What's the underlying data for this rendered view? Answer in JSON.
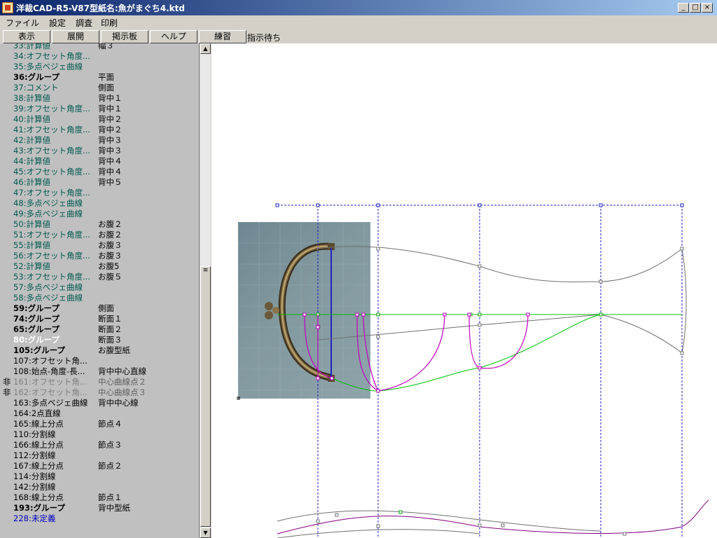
{
  "window": {
    "title": "洋裁CAD-R5-V87型紙名:魚がまぐち4.ktd"
  },
  "menubar": {
    "items": [
      "ファイル",
      "設定",
      "調査",
      "印刷"
    ]
  },
  "toolbar": {
    "buttons": [
      "表示",
      "展開",
      "掲示板",
      "ヘルプ",
      "練習"
    ],
    "status": "指示待ち"
  },
  "colors": {
    "teal": "#005a50",
    "black": "#000000",
    "white": "#ffffff",
    "gray": "#808080",
    "blue": "#0000c0",
    "magenta": "#c000c0",
    "green": "#00c000",
    "dashed_blue": "#2020c0"
  },
  "tree": [
    {
      "prefix": "",
      "label": "33:計算値",
      "note": "幅３",
      "color": "teal",
      "bold": false
    },
    {
      "prefix": "",
      "label": "34:オフセット角度...",
      "note": "",
      "color": "teal",
      "bold": false
    },
    {
      "prefix": "",
      "label": "35:多点ベジェ曲線",
      "note": "",
      "color": "teal",
      "bold": false
    },
    {
      "prefix": "",
      "label": "36:グループ",
      "note": "平面",
      "color": "black",
      "bold": true
    },
    {
      "prefix": "",
      "label": "37:コメント",
      "note": "側面",
      "color": "teal",
      "bold": false
    },
    {
      "prefix": "",
      "label": "38:計算値",
      "note": "背中１",
      "color": "teal",
      "bold": false
    },
    {
      "prefix": "",
      "label": "39:オフセット角度...",
      "note": "背中１",
      "color": "teal",
      "bold": false
    },
    {
      "prefix": "",
      "label": "40:計算値",
      "note": "背中２",
      "color": "teal",
      "bold": false
    },
    {
      "prefix": "",
      "label": "41:オフセット角度...",
      "note": "背中２",
      "color": "teal",
      "bold": false
    },
    {
      "prefix": "",
      "label": "42:計算値",
      "note": "背中３",
      "color": "teal",
      "bold": false
    },
    {
      "prefix": "",
      "label": "43:オフセット角度...",
      "note": "背中３",
      "color": "teal",
      "bold": false
    },
    {
      "prefix": "",
      "label": "44:計算値",
      "note": "背中４",
      "color": "teal",
      "bold": false
    },
    {
      "prefix": "",
      "label": "45:オフセット角度...",
      "note": "背中４",
      "color": "teal",
      "bold": false
    },
    {
      "prefix": "",
      "label": "46:計算値",
      "note": "背中５",
      "color": "teal",
      "bold": false
    },
    {
      "prefix": "",
      "label": "47:オフセット角度...",
      "note": "",
      "color": "teal",
      "bold": false
    },
    {
      "prefix": "",
      "label": "48:多点ベジェ曲線",
      "note": "",
      "color": "teal",
      "bold": false
    },
    {
      "prefix": "",
      "label": "49:多点ベジェ曲線",
      "note": "",
      "color": "teal",
      "bold": false
    },
    {
      "prefix": "",
      "label": "50:計算値",
      "note": "お腹２",
      "color": "teal",
      "bold": false
    },
    {
      "prefix": "",
      "label": "51:オフセット角度...",
      "note": "お腹２",
      "color": "teal",
      "bold": false
    },
    {
      "prefix": "",
      "label": "55:計算値",
      "note": "お腹３",
      "color": "teal",
      "bold": false
    },
    {
      "prefix": "",
      "label": "56:オフセット角度...",
      "note": "お腹３",
      "color": "teal",
      "bold": false
    },
    {
      "prefix": "",
      "label": "52:計算値",
      "note": "お腹5",
      "color": "teal",
      "bold": false
    },
    {
      "prefix": "",
      "label": "53:オフセット角度...",
      "note": "お腹５",
      "color": "teal",
      "bold": false
    },
    {
      "prefix": "",
      "label": "57:多点ベジェ曲線",
      "note": "",
      "color": "teal",
      "bold": false
    },
    {
      "prefix": "",
      "label": "58:多点ベジェ曲線",
      "note": "",
      "color": "teal",
      "bold": false
    },
    {
      "prefix": "",
      "label": "59:グループ",
      "note": "側面",
      "color": "black",
      "bold": true
    },
    {
      "prefix": "",
      "label": "74:グループ",
      "note": "断面１",
      "color": "black",
      "bold": true
    },
    {
      "prefix": "",
      "label": "65:グループ",
      "note": "断面２",
      "color": "black",
      "bold": true
    },
    {
      "prefix": "",
      "label": "80:グループ",
      "note": "断面３",
      "color": "white",
      "bold": true
    },
    {
      "prefix": "",
      "label": "105:グループ",
      "note": "お腹型紙",
      "color": "black",
      "bold": true
    },
    {
      "prefix": "",
      "label": "107:オフセット角...",
      "note": "",
      "color": "black",
      "bold": false
    },
    {
      "prefix": "",
      "label": "108:始点-角度-長...",
      "note": "背中中心直線",
      "color": "black",
      "bold": false
    },
    {
      "prefix": "非",
      "label": "161:オフセット角...",
      "note": "中心曲線点２",
      "color": "gray",
      "bold": false
    },
    {
      "prefix": "非",
      "label": "162:オフセット角...",
      "note": "中心曲線点３",
      "color": "gray",
      "bold": false
    },
    {
      "prefix": "",
      "label": "163:多点ベジェ曲線",
      "note": "背中中心線",
      "color": "black",
      "bold": false
    },
    {
      "prefix": "",
      "label": "164:2点直線",
      "note": "",
      "color": "black",
      "bold": false
    },
    {
      "prefix": "",
      "label": "165:線上分点",
      "note": "節点４",
      "color": "black",
      "bold": false
    },
    {
      "prefix": "",
      "label": "110:分割線",
      "note": "",
      "color": "black",
      "bold": false
    },
    {
      "prefix": "",
      "label": "166:線上分点",
      "note": "節点３",
      "color": "black",
      "bold": false
    },
    {
      "prefix": "",
      "label": "112:分割線",
      "note": "",
      "color": "black",
      "bold": false
    },
    {
      "prefix": "",
      "label": "167:線上分点",
      "note": "節点２",
      "color": "black",
      "bold": false
    },
    {
      "prefix": "",
      "label": "114:分割線",
      "note": "",
      "color": "black",
      "bold": false
    },
    {
      "prefix": "",
      "label": "142:分割線",
      "note": "",
      "color": "black",
      "bold": false
    },
    {
      "prefix": "",
      "label": "168:線上分点",
      "note": "節点１",
      "color": "black",
      "bold": false
    },
    {
      "prefix": "",
      "label": "193:グループ",
      "note": "背中型紙",
      "color": "black",
      "bold": true
    },
    {
      "prefix": "",
      "label": "228:未定義",
      "note": "",
      "color": "blue",
      "bold": false
    }
  ],
  "icons": {
    "minimize": "minimize-icon",
    "maximize": "maximize-icon",
    "close": "close-icon"
  }
}
